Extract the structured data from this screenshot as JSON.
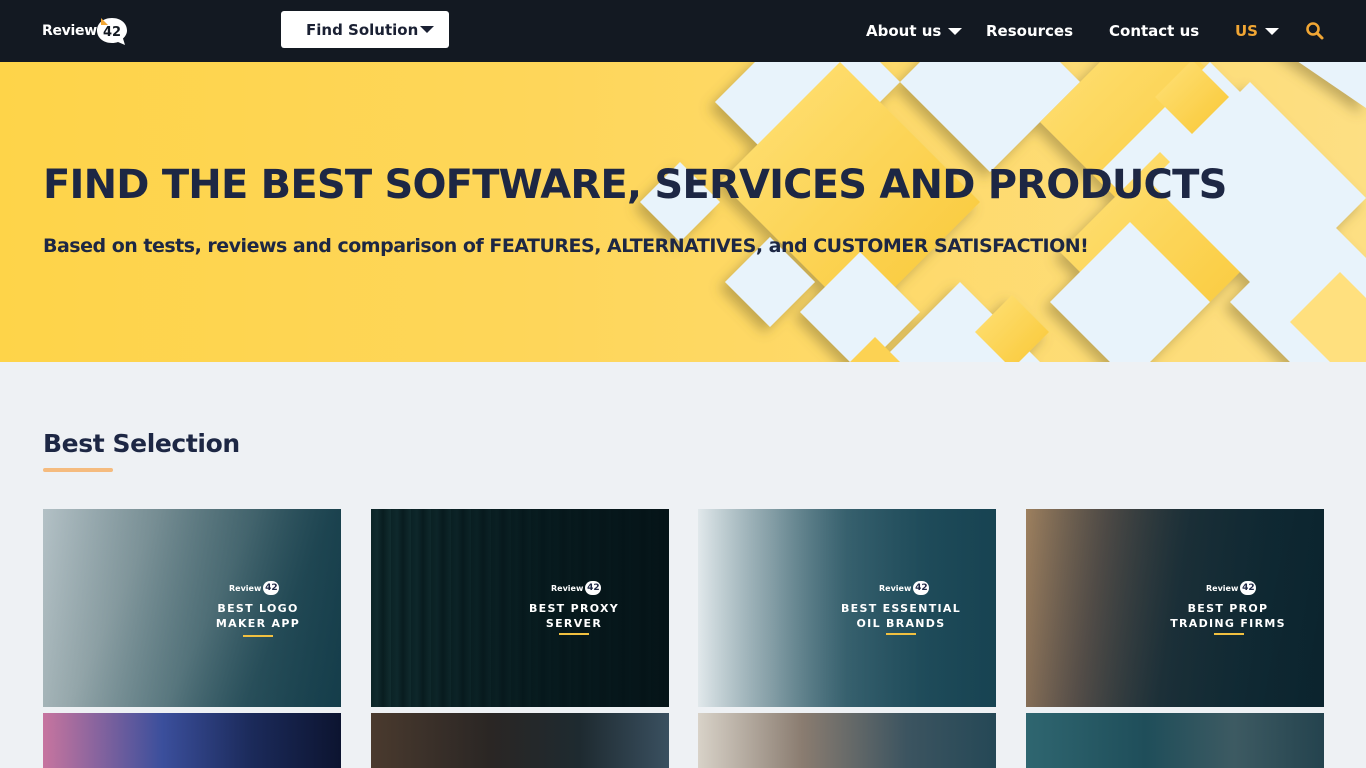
{
  "header": {
    "logo_text": "Review",
    "logo_badge": "42",
    "find_solution_label": "Find Solution",
    "nav": {
      "about": "About us",
      "resources": "Resources",
      "contact": "Contact us",
      "region": "US"
    },
    "colors": {
      "bar": "#131922",
      "accent": "#f1a634"
    }
  },
  "hero": {
    "title": "FIND THE BEST SOFTWARE, SERVICES AND PRODUCTS",
    "subtitle": "Based on tests, reviews and comparison of FEATURES, ALTERNATIVES, and CUSTOMER SATISFACTION!",
    "colors": {
      "yellow": "#fed449",
      "light_blue": "#e8f3fb"
    }
  },
  "best_selection": {
    "title": "Best Selection",
    "cards": [
      {
        "brand": "Review",
        "badge": "42",
        "title": "BEST LOGO\nMAKER APP"
      },
      {
        "brand": "Review",
        "badge": "42",
        "title": "BEST PROXY\nSERVER"
      },
      {
        "brand": "Review",
        "badge": "42",
        "title": "BEST ESSENTIAL\nOIL BRANDS"
      },
      {
        "brand": "Review",
        "badge": "42",
        "title": "BEST PROP\nTRADING FIRMS"
      }
    ]
  }
}
